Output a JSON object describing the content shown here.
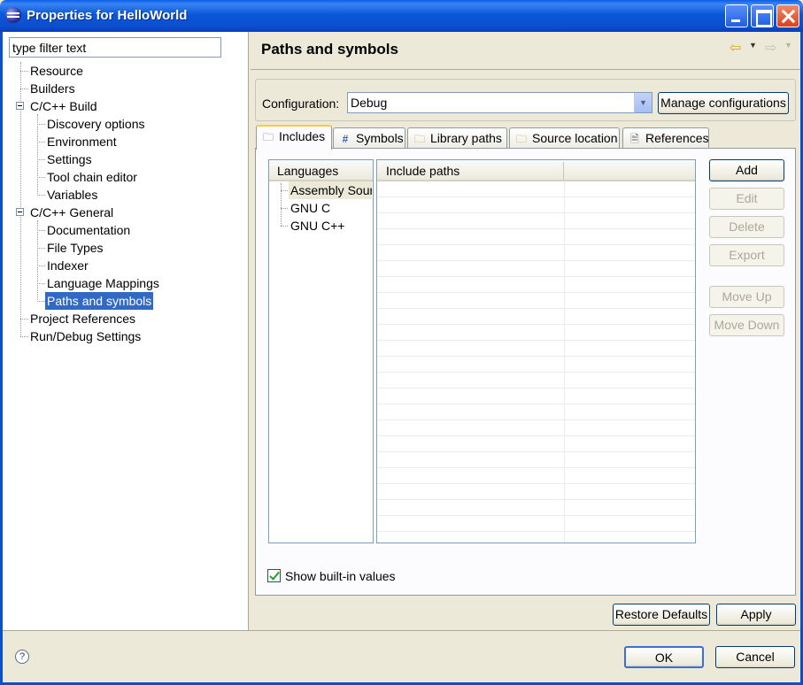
{
  "window": {
    "title": "Properties for HelloWorld"
  },
  "filter": {
    "value": "type filter text"
  },
  "tree": {
    "resource": "Resource",
    "builders": "Builders",
    "cpp_build": "C/C++ Build",
    "discovery": "Discovery options",
    "environment": "Environment",
    "settings": "Settings",
    "toolchain": "Tool chain editor",
    "variables": "Variables",
    "cpp_general": "C/C++ General",
    "documentation": "Documentation",
    "filetypes": "File Types",
    "indexer": "Indexer",
    "langmap": "Language Mappings",
    "paths": "Paths and symbols",
    "projrefs": "Project References",
    "rundebug": "Run/Debug Settings"
  },
  "page": {
    "title": "Paths and symbols"
  },
  "config": {
    "label": "Configuration:",
    "value": "Debug",
    "manage_label": "Manage configurations"
  },
  "tabs": {
    "includes": "Includes",
    "symbols": "Symbols",
    "library_paths": "Library paths",
    "source_location": "Source location",
    "references": "References"
  },
  "languages": {
    "header": "Languages",
    "items": [
      "Assembly Source",
      "GNU C",
      "GNU C++"
    ]
  },
  "includes": {
    "header": "Include paths"
  },
  "buttons": {
    "add": "Add",
    "edit": "Edit",
    "delete": "Delete",
    "export": "Export",
    "move_up": "Move Up",
    "move_down": "Move Down",
    "restore": "Restore Defaults",
    "apply": "Apply",
    "ok": "OK",
    "cancel": "Cancel"
  },
  "show_builtin": {
    "label": "Show built-in values",
    "checked": true
  }
}
